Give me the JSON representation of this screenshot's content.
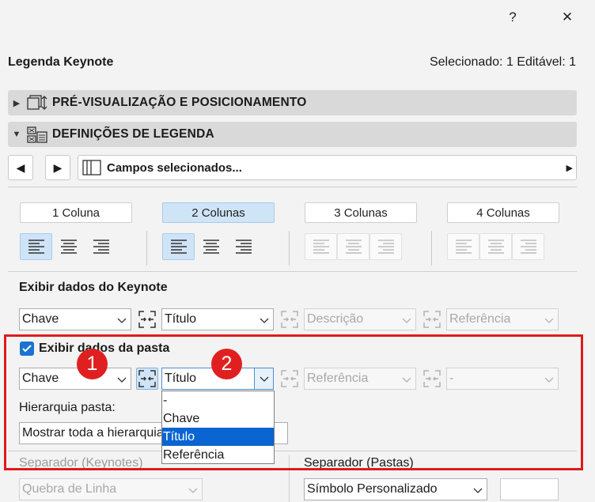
{
  "window": {
    "help_label": "?",
    "close_label": "✕"
  },
  "header": {
    "title": "Legenda Keynote",
    "selection_info": "Selecionado: 1 Editável: 1"
  },
  "sections": [
    {
      "label": "PRÉ-VISUALIZAÇÃO E POSICIONAMENTO",
      "expanded": false
    },
    {
      "label": "DEFINIÇÕES DE LEGENDA",
      "expanded": true
    }
  ],
  "fields_bar": {
    "label": "Campos selecionados..."
  },
  "columns": [
    "1 Coluna",
    "2 Colunas",
    "3 Colunas",
    "4 Colunas"
  ],
  "selected_column": "2 Colunas",
  "keynote": {
    "heading": "Exibir dados do Keynote",
    "dropdowns": [
      "Chave",
      "Título",
      "Descrição",
      "Referência"
    ]
  },
  "folder": {
    "checkbox_label": "Exibir dados da pasta",
    "checked": true,
    "dropdowns": [
      "Chave",
      "Título",
      "Referência",
      "-"
    ],
    "hierarchy_label": "Hierarquia pasta:",
    "hierarchy_value": "Mostrar toda a hierarquia",
    "open_list": [
      "-",
      "Chave",
      "Título",
      "Referência"
    ],
    "open_list_selected": "Título"
  },
  "separators": {
    "keynotes_label": "Separador (Keynotes)",
    "keynotes_value": "Quebra de Linha",
    "folders_label": "Separador (Pastas)",
    "folders_value": "Símbolo Personalizado"
  },
  "annotations": [
    "1",
    "2"
  ],
  "colors": {
    "accent": "#1a73d0",
    "selection": "#0a64d2",
    "highlight_box": "#e01b1b",
    "active_tab": "#cfe4f7"
  }
}
